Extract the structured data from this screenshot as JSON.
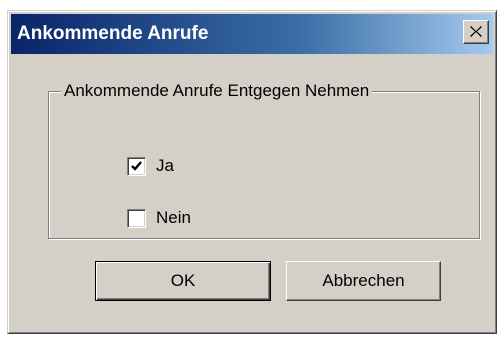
{
  "dialog": {
    "title": "Ankommende Anrufe",
    "close_icon": "close-icon",
    "group": {
      "label": "Ankommende Anrufe Entgegen Nehmen",
      "options": [
        {
          "label": "Ja",
          "checked": true
        },
        {
          "label": "Nein",
          "checked": false
        }
      ]
    },
    "buttons": {
      "ok": "OK",
      "cancel": "Abbrechen"
    }
  },
  "colors": {
    "titlebar_start": "#0a246a",
    "titlebar_end": "#a6caf0",
    "face": "#d4d0c8"
  }
}
